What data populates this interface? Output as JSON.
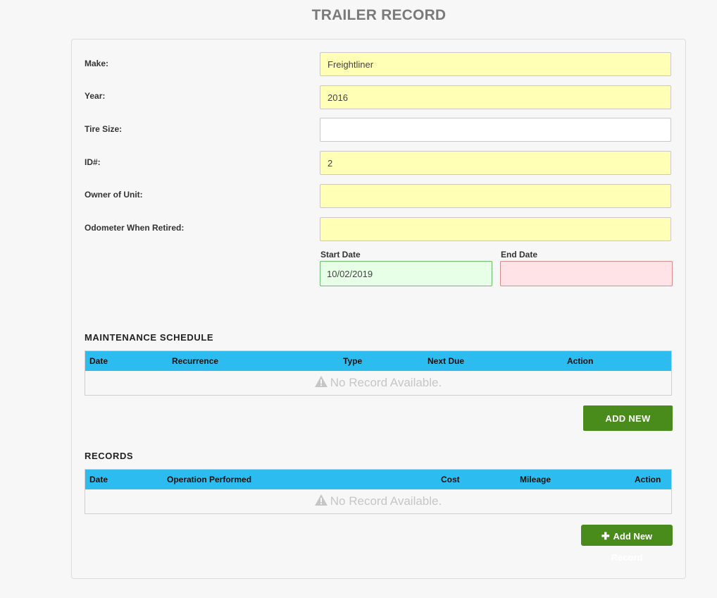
{
  "page": {
    "title": "TRAILER RECORD"
  },
  "form": {
    "make": {
      "label": "Make:",
      "value": "Freightliner"
    },
    "year": {
      "label": "Year:",
      "value": "2016"
    },
    "tire_size": {
      "label": "Tire Size:",
      "value": ""
    },
    "id": {
      "label": "ID#:",
      "value": "2"
    },
    "owner": {
      "label": "Owner of Unit:",
      "value": ""
    },
    "odometer": {
      "label": "Odometer When Retired:",
      "value": ""
    },
    "start_date": {
      "label": "Start Date",
      "value": "10/02/2019"
    },
    "end_date": {
      "label": "End Date",
      "value": ""
    }
  },
  "maintenance": {
    "title": "MAINTENANCE SCHEDULE",
    "columns": [
      "Date",
      "Recurrence",
      "Type",
      "Next Due",
      "Action"
    ],
    "empty_text": "No Record Available.",
    "add_button": "ADD NEW"
  },
  "records": {
    "title": "RECORDS",
    "columns": [
      "Date",
      "Operation Performed",
      "Cost",
      "Mileage",
      "Action"
    ],
    "empty_text": "No Record Available.",
    "add_button": "Add New Record"
  },
  "colors": {
    "header_blue": "#2dbcf0",
    "button_green": "#4a8c1c",
    "required_yellow": "#ffffb5",
    "start_green": "#e6ffe6",
    "end_red": "#ffe3e6"
  },
  "icons": {
    "empty": "warning-icon",
    "add": "plus-icon"
  }
}
